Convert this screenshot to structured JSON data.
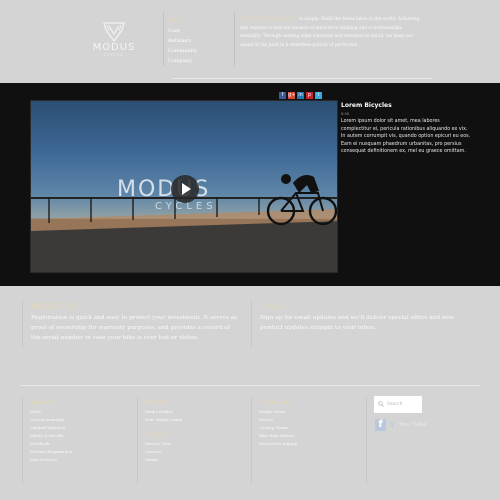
{
  "header": {
    "logo": {
      "word": "MODUS",
      "sub": "CYCLES"
    },
    "nav": [
      {
        "label": "Ebay",
        "active": true
      },
      {
        "label": "User",
        "active": false
      },
      {
        "label": "Retailers",
        "active": false
      },
      {
        "label": "Community",
        "active": false
      },
      {
        "label": "Company",
        "active": false
      }
    ],
    "intro": {
      "brand": "The Modus Cycles mission",
      "text": " is simple: Build the finest bikes in the world. Achieving this requires a delicate balance of innovative thinking and a craftsmanlike mentality. Through seeking edge materials and attention to detail, we keep our ahead of the pack in a relentless pursuit of perfection."
    }
  },
  "share": [
    "f",
    "g+",
    "in",
    "p",
    "t"
  ],
  "video": {
    "overlay_title": "MODUS",
    "overlay_sub": "CYCLES",
    "info_title": "Lorem Bicycles",
    "info_duration": "0:00",
    "info_body": "Lorem ipsum dolor sit amet, mea labores complectitur ei, pericula rationibus aliquando ex vix. In autem corrumpit vis, quando option epicuri eu eos. Eam ei nusquam phaedrum urbanitas, pro persius consequat definitionem ex, mel eu graece omittam."
  },
  "register": {
    "title": "REGISTER",
    "body": "Registration is quick and easy to protect your investment. It serves as proof of ownership for warranty purposes, and provides a record of the serial number in case your bike is ever lost or stolen."
  },
  "email": {
    "title": "EMAIL",
    "body": "Sign up for email updates and we'll deliver special offers and new product updates straight to your inbox."
  },
  "footer": {
    "support": {
      "title": "Support",
      "links": [
        "FAQs",
        "Owners manuals",
        "Limited Warranty",
        "Safety & Recalls",
        "Feedback",
        "Product Registration",
        "Site Archives"
      ]
    },
    "retailers": {
      "title": "Retailers",
      "links": [
        "Find a Dealer",
        "Your Dealer Guide"
      ]
    },
    "company": {
      "title": "Company",
      "links": [
        "Factory Tour",
        "Careers",
        "Media"
      ]
    },
    "community": {
      "title": "Community",
      "links": [
        "Modus News",
        "Events",
        "Cycling Teams",
        "Bike Ride Stories",
        "Newsletter Signup"
      ]
    },
    "search_placeholder": "Search",
    "social": {
      "facebook": "f",
      "twitter": "t",
      "youtube": "You Tube"
    }
  },
  "colors": {
    "background": "#d4d4d4",
    "band": "#101010",
    "accent": "#e7d8b4"
  }
}
